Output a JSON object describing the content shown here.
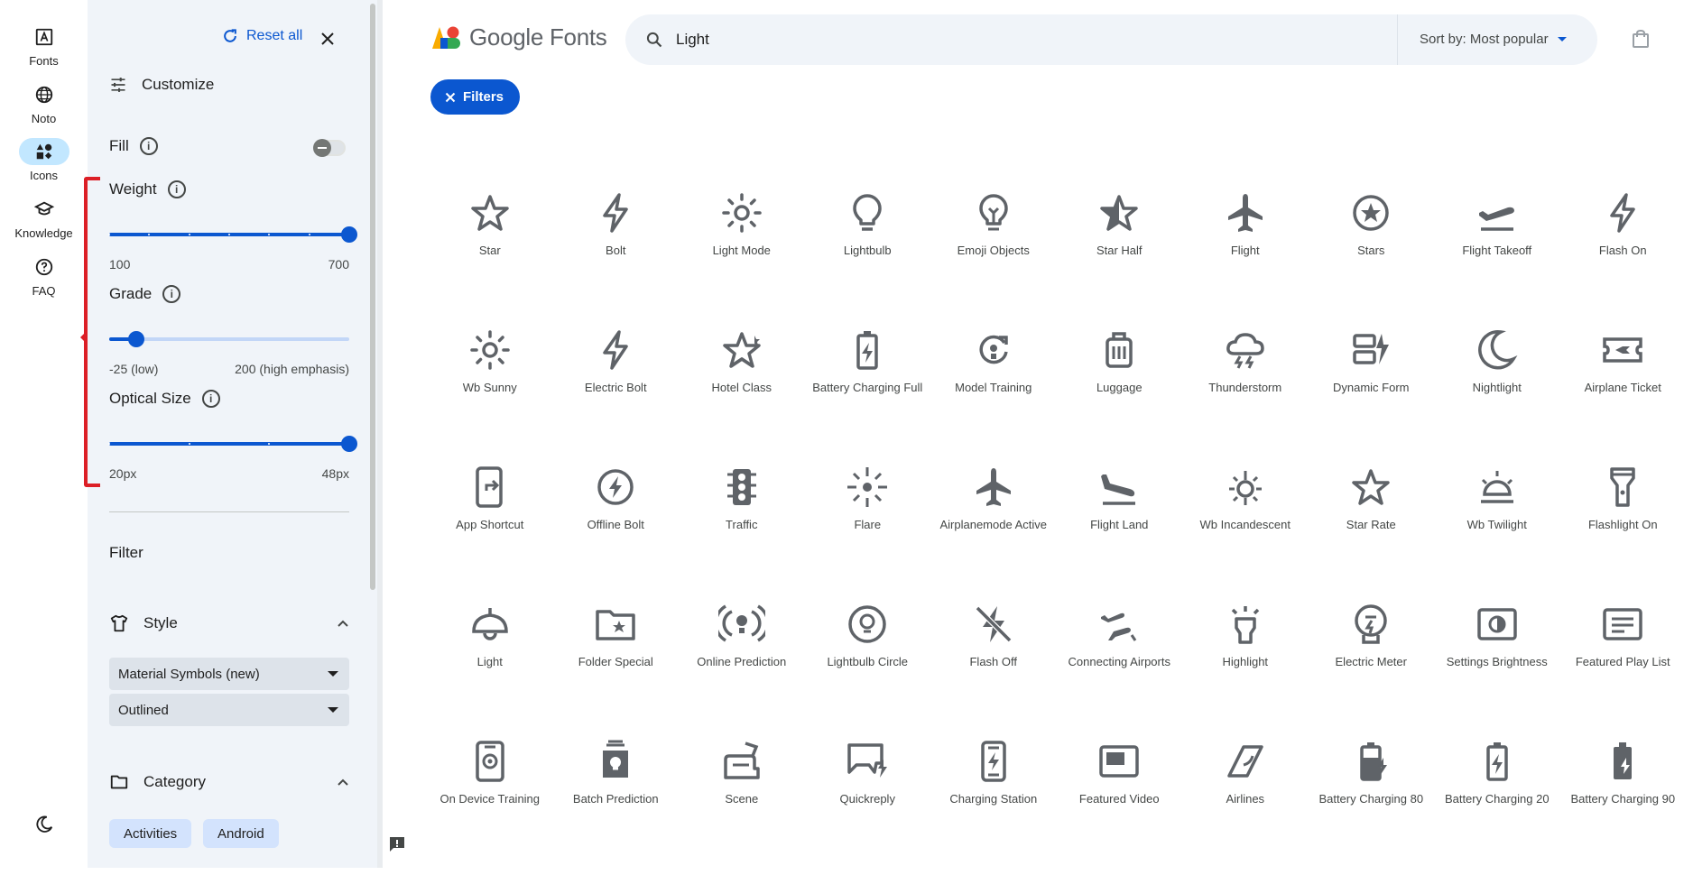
{
  "rail": {
    "items": [
      {
        "label": "Fonts",
        "icon": "text-box-icon"
      },
      {
        "label": "Noto",
        "icon": "globe-icon"
      },
      {
        "label": "Icons",
        "icon": "shapes-icon"
      },
      {
        "label": "Knowledge",
        "icon": "school-icon"
      },
      {
        "label": "FAQ",
        "icon": "help-icon"
      }
    ],
    "active": "Icons",
    "theme_icon": "dark-mode-icon"
  },
  "panel": {
    "reset_label": "Reset all",
    "customize_label": "Customize",
    "fill": {
      "label": "Fill",
      "enabled": false
    },
    "weight": {
      "label": "Weight",
      "min_label": "100",
      "max_label": "700",
      "value": 700,
      "min": 100,
      "max": 700
    },
    "grade": {
      "label": "Grade",
      "min_label": "-25 (low)",
      "max_label": "200 (high emphasis)",
      "value": 0,
      "min": -25,
      "max": 200
    },
    "optical_size": {
      "label": "Optical Size",
      "min_label": "20px",
      "max_label": "48px",
      "value": 48,
      "min": 20,
      "max": 48
    },
    "filter_label": "Filter",
    "style": {
      "label": "Style",
      "family": "Material Symbols (new)",
      "variant": "Outlined"
    },
    "category": {
      "label": "Category",
      "chips": [
        "Activities",
        "Android"
      ]
    }
  },
  "header": {
    "logo_text": "Google Fonts",
    "search_value": "Light",
    "sort_label": "Sort by: Most popular"
  },
  "filters_button": "Filters",
  "icons": [
    "Star",
    "Bolt",
    "Light Mode",
    "Lightbulb",
    "Emoji Objects",
    "Star Half",
    "Flight",
    "Stars",
    "Flight Takeoff",
    "Flash On",
    "Wb Sunny",
    "Electric Bolt",
    "Hotel Class",
    "Battery Charging Full",
    "Model Training",
    "Luggage",
    "Thunderstorm",
    "Dynamic Form",
    "Nightlight",
    "Airplane Ticket",
    "App Shortcut",
    "Offline Bolt",
    "Traffic",
    "Flare",
    "Airplanemode Active",
    "Flight Land",
    "Wb Incandescent",
    "Star Rate",
    "Wb Twilight",
    "Flashlight On",
    "Light",
    "Folder Special",
    "Online Prediction",
    "Lightbulb Circle",
    "Flash Off",
    "Connecting Airports",
    "Highlight",
    "Electric Meter",
    "Settings Brightness",
    "Featured Play List",
    "On Device Training",
    "Batch Prediction",
    "Scene",
    "Quickreply",
    "Charging Station",
    "Featured Video",
    "Airlines",
    "Battery Charging 80",
    "Battery Charging 20",
    "Battery Charging 90"
  ],
  "colors": {
    "accent": "#0b57d0",
    "panel_bg": "#f0f4f9",
    "icon": "#5f6368",
    "annotation": "#dc1f26"
  }
}
